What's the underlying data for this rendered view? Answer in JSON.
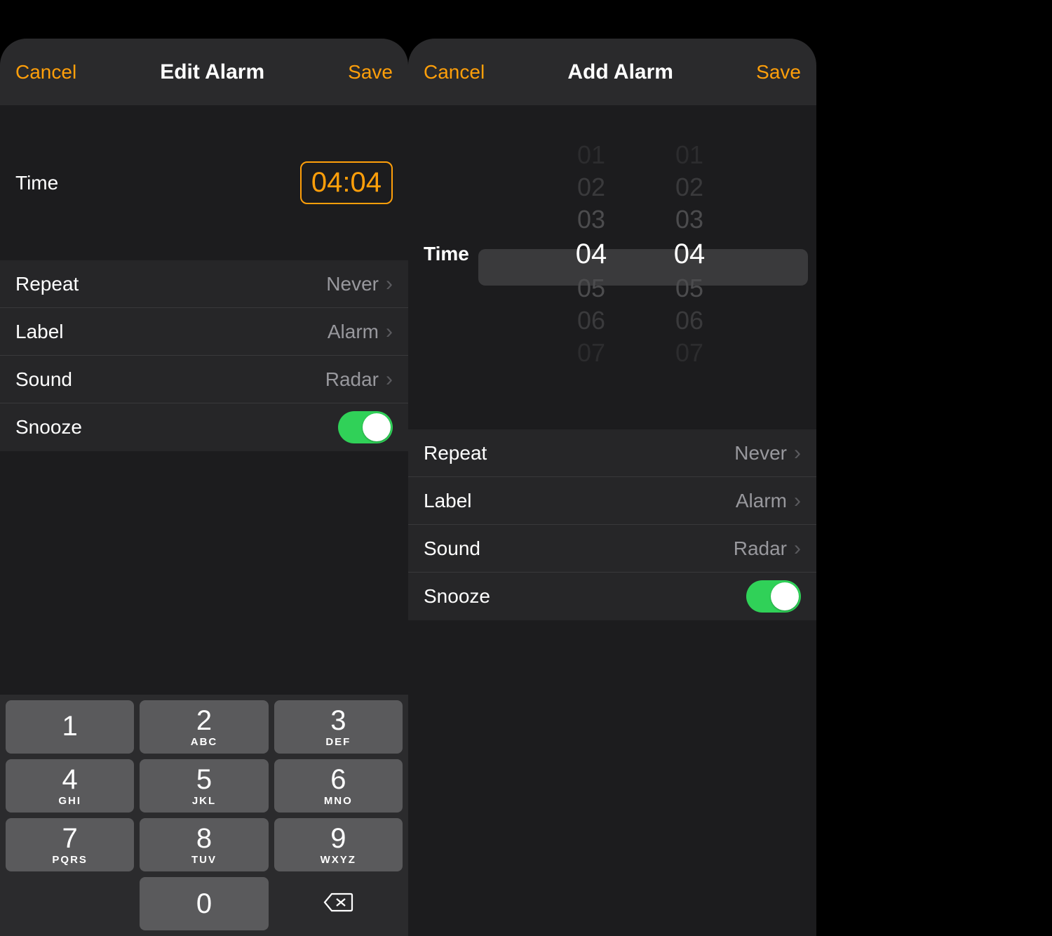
{
  "left": {
    "cancel": "Cancel",
    "title": "Edit Alarm",
    "save": "Save",
    "time_label": "Time",
    "time_value": "04:04",
    "rows": {
      "repeat": {
        "key": "Repeat",
        "val": "Never"
      },
      "label": {
        "key": "Label",
        "val": "Alarm"
      },
      "sound": {
        "key": "Sound",
        "val": "Radar"
      },
      "snooze": {
        "key": "Snooze",
        "on": true
      }
    },
    "keypad": [
      {
        "digit": "1",
        "letters": ""
      },
      {
        "digit": "2",
        "letters": "ABC"
      },
      {
        "digit": "3",
        "letters": "DEF"
      },
      {
        "digit": "4",
        "letters": "GHI"
      },
      {
        "digit": "5",
        "letters": "JKL"
      },
      {
        "digit": "6",
        "letters": "MNO"
      },
      {
        "digit": "7",
        "letters": "PQRS"
      },
      {
        "digit": "8",
        "letters": "TUV"
      },
      {
        "digit": "9",
        "letters": "WXYZ"
      },
      {
        "digit": "0",
        "letters": ""
      }
    ]
  },
  "right": {
    "cancel": "Cancel",
    "title": "Add Alarm",
    "save": "Save",
    "time_label": "Time",
    "wheel_hours": [
      "01",
      "02",
      "03",
      "04",
      "05",
      "06",
      "07"
    ],
    "wheel_minutes": [
      "01",
      "02",
      "03",
      "04",
      "05",
      "06",
      "07"
    ],
    "rows": {
      "repeat": {
        "key": "Repeat",
        "val": "Never"
      },
      "label": {
        "key": "Label",
        "val": "Alarm"
      },
      "sound": {
        "key": "Sound",
        "val": "Radar"
      },
      "snooze": {
        "key": "Snooze",
        "on": true
      }
    }
  },
  "colors": {
    "accent": "#ff9f0a",
    "toggle_on": "#30d158"
  }
}
